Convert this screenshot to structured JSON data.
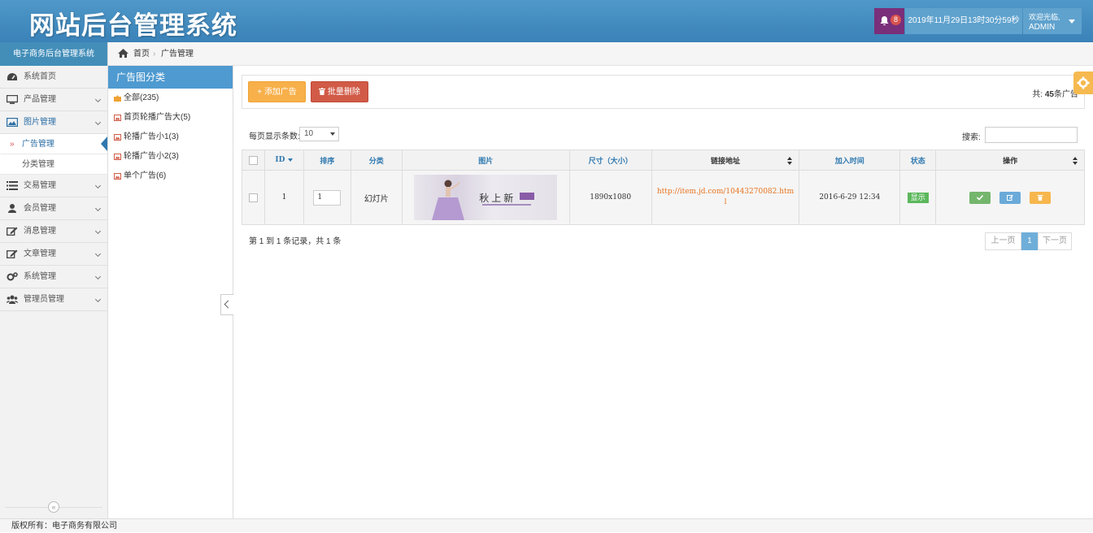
{
  "header": {
    "title": "网站后台管理系统",
    "notification_count": "8",
    "datetime": "2019年11月29日13时30分59秒",
    "welcome": "欢迎光临,",
    "username": "ADMIN"
  },
  "sidebar": {
    "title": "电子商务后台管理系统",
    "items": [
      {
        "label": "系统首页",
        "icon": "dashboard-icon"
      },
      {
        "label": "产品管理",
        "icon": "monitor-icon"
      },
      {
        "label": "图片管理",
        "icon": "picture-icon",
        "open": true
      },
      {
        "label": "交易管理",
        "icon": "list-icon"
      },
      {
        "label": "会员管理",
        "icon": "user-icon"
      },
      {
        "label": "消息管理",
        "icon": "edit-icon"
      },
      {
        "label": "文章管理",
        "icon": "edit-icon"
      },
      {
        "label": "系统管理",
        "icon": "cogs-icon"
      },
      {
        "label": "管理员管理",
        "icon": "users-icon"
      }
    ],
    "sub_items": [
      {
        "label": "广告管理",
        "active": true
      },
      {
        "label": "分类管理"
      }
    ],
    "collapse_glyph": "«"
  },
  "breadcrumb": {
    "home": "首页",
    "separator": "›",
    "current": "广告管理"
  },
  "category_panel": {
    "title": "广告图分类",
    "items": [
      "全部(235)",
      "首页轮播广告大(5)",
      "轮播广告小1(3)",
      "轮播广告小2(3)",
      "单个广告(6)"
    ]
  },
  "toolbar": {
    "add_label": "添加广告",
    "batch_delete_label": "批量删除",
    "total_prefix": "共:",
    "total_count": "45",
    "total_suffix": "条广告"
  },
  "table_controls": {
    "length_label": "每页显示条数:",
    "length_value": "10",
    "search_label": "搜索:",
    "search_value": ""
  },
  "table": {
    "headers": [
      "ID",
      "排序",
      "分类",
      "图片",
      "尺寸（大小）",
      "链接地址",
      "加入时间",
      "状态",
      "操作"
    ],
    "rows": [
      {
        "id": "1",
        "order": "1",
        "category": "幻灯片",
        "image_text": "秋上新",
        "size": "1890x1080",
        "link": "http://item.jd.com/10443270082.html",
        "added": "2016-6-29 12:34",
        "status": "显示"
      }
    ]
  },
  "pagination": {
    "info": "第 1 到 1 条记录，共 1 条",
    "prev": "上一页",
    "current": "1",
    "next": "下一页"
  },
  "footer": {
    "text": "版权所有：电子商务有限公司"
  },
  "colors": {
    "header": "#438eb9",
    "accent": "#2f79b0",
    "add_button": "#f7b04a",
    "delete_button": "#d15b47",
    "status_show": "#5cb85c"
  }
}
